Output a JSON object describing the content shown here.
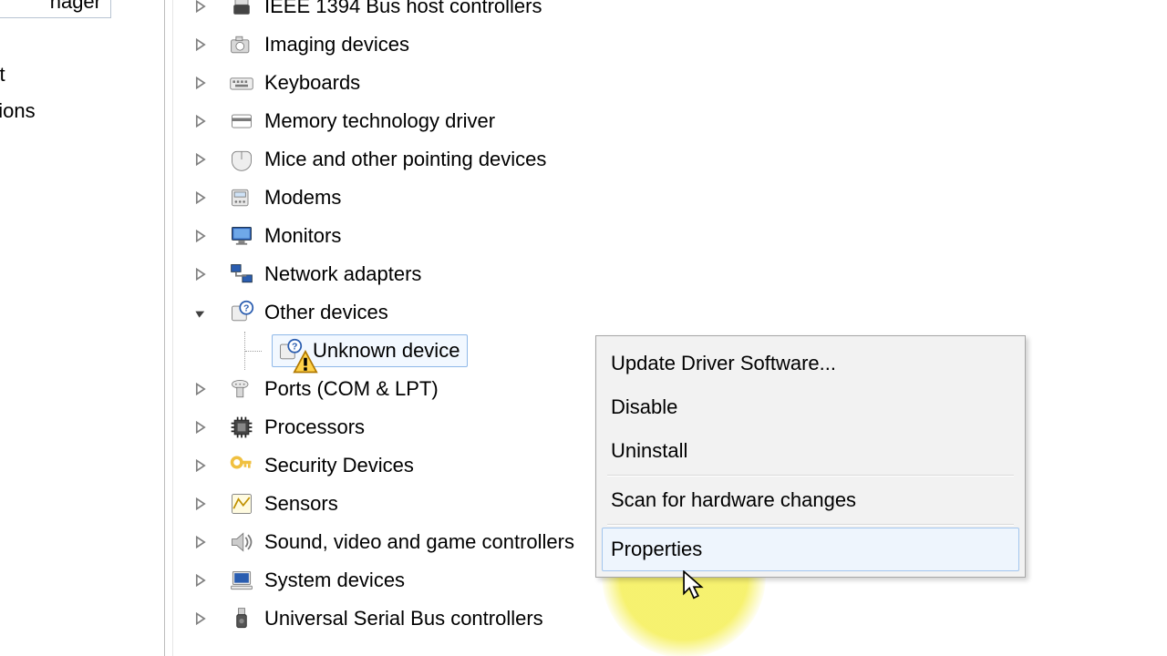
{
  "sidebar": {
    "box_text": "nager",
    "items": [
      "agement",
      "Applications"
    ]
  },
  "tree": [
    {
      "id": "ieee1394",
      "label": "IEEE 1394 Bus host controllers",
      "icon": "ieee1394-icon",
      "expanded": false
    },
    {
      "id": "imaging",
      "label": "Imaging devices",
      "icon": "camera-icon",
      "expanded": false
    },
    {
      "id": "keyboards",
      "label": "Keyboards",
      "icon": "keyboard-icon",
      "expanded": false
    },
    {
      "id": "memtech",
      "label": "Memory technology driver",
      "icon": "card-icon",
      "expanded": false
    },
    {
      "id": "mice",
      "label": "Mice and other pointing devices",
      "icon": "mouse-icon",
      "expanded": false
    },
    {
      "id": "modems",
      "label": "Modems",
      "icon": "modem-icon",
      "expanded": false
    },
    {
      "id": "monitors",
      "label": "Monitors",
      "icon": "monitor-icon",
      "expanded": false
    },
    {
      "id": "network",
      "label": "Network adapters",
      "icon": "network-icon",
      "expanded": false
    },
    {
      "id": "other",
      "label": "Other devices",
      "icon": "unknown-category-icon",
      "expanded": true,
      "children": [
        {
          "id": "unknown",
          "label": "Unknown device",
          "icon": "unknown-device-icon",
          "selected": true,
          "warning": true
        }
      ]
    },
    {
      "id": "ports",
      "label": "Ports (COM & LPT)",
      "icon": "ports-icon",
      "expanded": false
    },
    {
      "id": "processors",
      "label": "Processors",
      "icon": "cpu-icon",
      "expanded": false
    },
    {
      "id": "security",
      "label": "Security Devices",
      "icon": "key-icon",
      "expanded": false
    },
    {
      "id": "sensors",
      "label": "Sensors",
      "icon": "sensor-icon",
      "expanded": false
    },
    {
      "id": "sound",
      "label": "Sound, video and game controllers",
      "icon": "speaker-icon",
      "expanded": false
    },
    {
      "id": "system",
      "label": "System devices",
      "icon": "system-icon",
      "expanded": false
    },
    {
      "id": "usb",
      "label": "Universal Serial Bus controllers",
      "icon": "usb-icon",
      "expanded": false
    }
  ],
  "context_menu": {
    "items": [
      {
        "id": "update",
        "label": "Update Driver Software..."
      },
      {
        "id": "disable",
        "label": "Disable"
      },
      {
        "id": "uninstall",
        "label": "Uninstall"
      },
      {
        "sep": true
      },
      {
        "id": "scan",
        "label": "Scan for hardware changes"
      },
      {
        "sep": true
      },
      {
        "id": "properties",
        "label": "Properties",
        "hover": true
      }
    ]
  }
}
